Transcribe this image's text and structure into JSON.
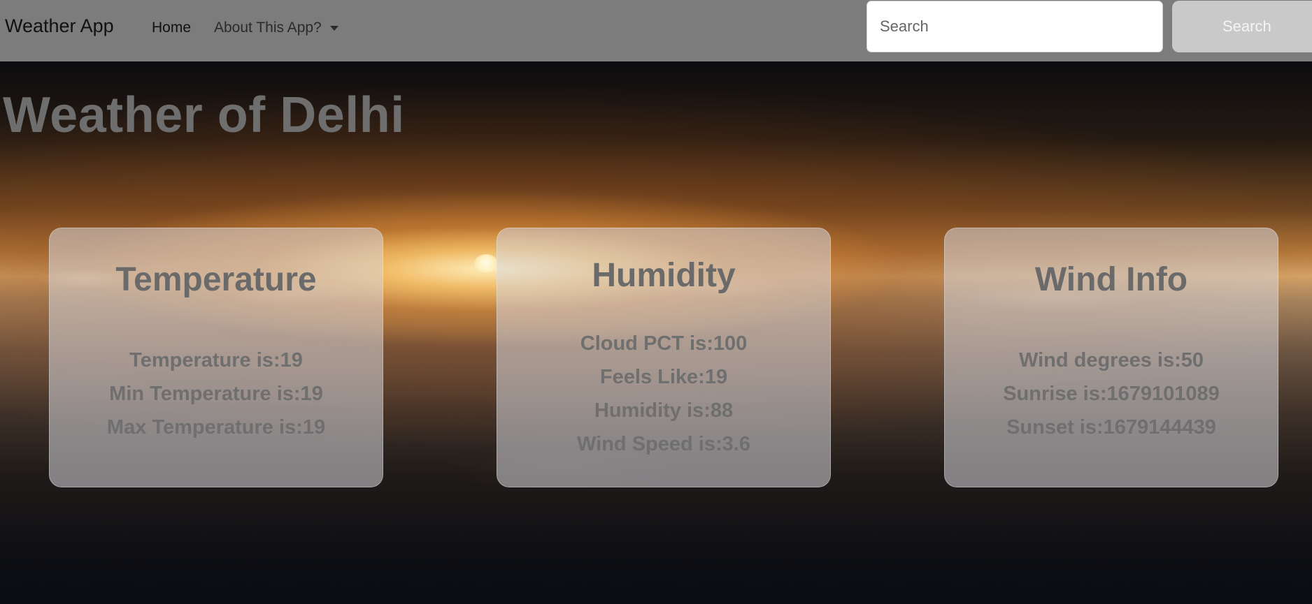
{
  "navbar": {
    "brand": "Weather App",
    "home_label": "Home",
    "about_label": "About This App?",
    "search_placeholder": "Search",
    "search_button_label": "Search"
  },
  "main": {
    "title": "Weather of Delhi"
  },
  "cards": {
    "temperature": {
      "title": "Temperature",
      "lines": [
        "Temperature is:19",
        "Min Temperature is:19",
        "Max Temperature is:19"
      ]
    },
    "humidity": {
      "title": "Humidity",
      "lines": [
        "Cloud PCT is:100",
        "Feels Like:19",
        "Humidity is:88",
        "Wind Speed is:3.6"
      ]
    },
    "wind": {
      "title": "Wind Info",
      "lines": [
        "Wind degrees is:50",
        "Sunrise is:1679101089",
        "Sunset is:1679144439"
      ]
    }
  },
  "colors": {
    "navbar_bg": "#808080",
    "card_text": "#6d6d6d",
    "search_button_bg": "#c9c9c9"
  },
  "icons": {
    "dropdown": "caret-down-icon"
  }
}
